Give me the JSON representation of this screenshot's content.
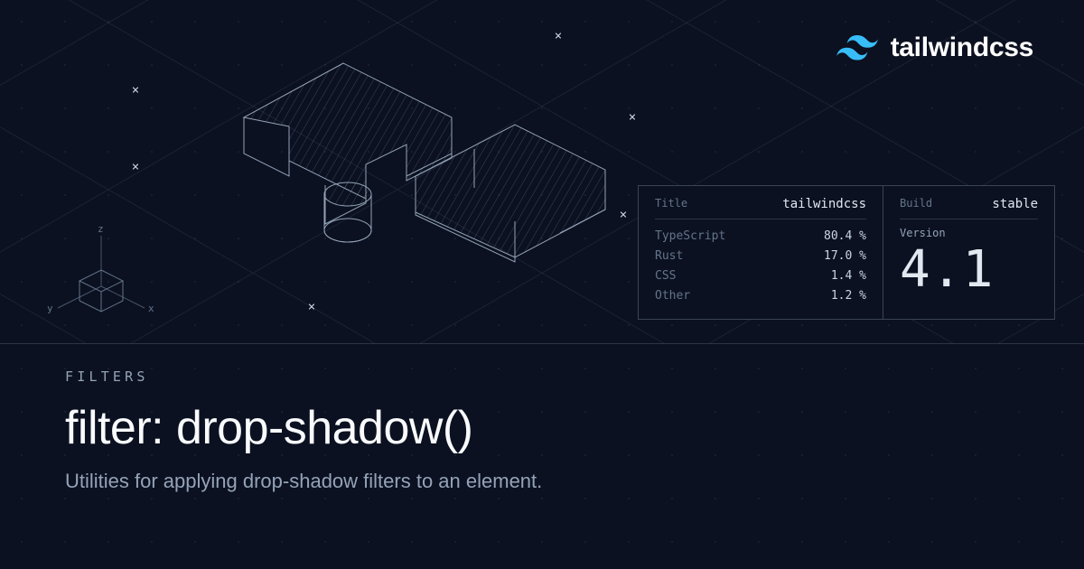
{
  "brand": {
    "name": "tailwindcss"
  },
  "panel": {
    "title_label": "Title",
    "title_value": "tailwindcss",
    "build_label": "Build",
    "build_value": "stable",
    "version_label": "Version",
    "version_value": "4.1",
    "langs": [
      {
        "name": "TypeScript",
        "pct": "80.4 %"
      },
      {
        "name": "Rust",
        "pct": "17.0 %"
      },
      {
        "name": "CSS",
        "pct": "1.4 %"
      },
      {
        "name": "Other",
        "pct": "1.2 %"
      }
    ]
  },
  "axes": {
    "x": "x",
    "y": "y",
    "z": "z"
  },
  "page": {
    "eyebrow": "FILTERS",
    "title": "filter: drop-shadow()",
    "subtitle": "Utilities for applying drop-shadow filters to an element."
  }
}
